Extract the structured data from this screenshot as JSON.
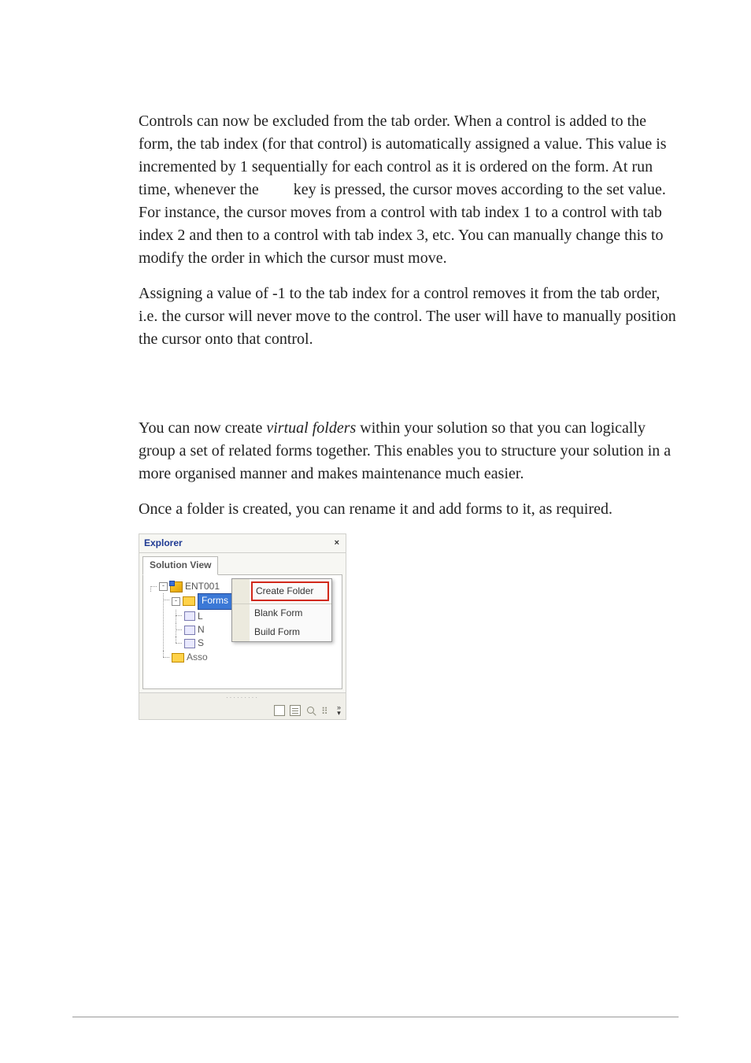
{
  "paragraphs": {
    "p1a": "Controls can now be excluded from the tab order. When a control is added to the form, the tab index (for that control) is automatically assigned a value. This value is incremented by 1 sequentially for each control as it is ordered on the form. At run time, whenever the ",
    "p1b": " key is pressed, the cursor moves according to the set value. For instance, the cursor moves from a control with tab index 1 to a control with tab index 2 and then to a control with tab index 3, etc. You can manually change this to modify the order in which the cursor must move.",
    "p2": "Assigning a value of -1 to the tab index for a control removes it from the tab order, i.e. the cursor will never move to the control. The user will have to manually position the cursor onto that control.",
    "p3a": "You can now create ",
    "p3italic": "virtual folders",
    "p3b": " within your solution so that you can logically group a set of related forms together. This enables you to structure your solution in a more organised manner and makes maintenance much easier.",
    "p4": "Once a folder is created, you can rename it and add forms to it, as required."
  },
  "explorer": {
    "title": "Explorer",
    "close": "×",
    "tab": "Solution View",
    "tree": {
      "project": "ENT001",
      "forms_label": "Forms",
      "child_l": "L",
      "child_n": "N",
      "child_s": "S",
      "asso": "Asso"
    },
    "context_menu": {
      "create_folder": "Create Folder",
      "blank_form": "Blank Form",
      "build_form": "Build Form"
    },
    "toolbar_chevrons": "»"
  }
}
